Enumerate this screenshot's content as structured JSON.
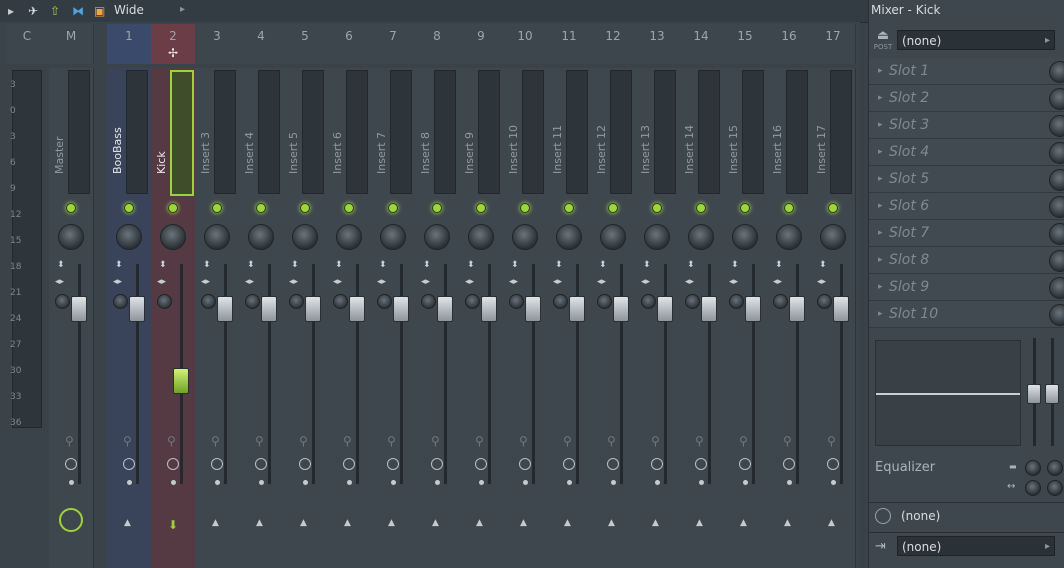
{
  "toolbar": {
    "mode_label": "Wide"
  },
  "mixer": {
    "headers": [
      "C",
      "M",
      "1",
      "2",
      "3",
      "4",
      "5",
      "6",
      "7",
      "8",
      "9",
      "10",
      "11",
      "12",
      "13",
      "14",
      "15",
      "16",
      "17"
    ],
    "selected_track": "2",
    "meter_scale": [
      "3",
      "0",
      "3",
      "6",
      "9",
      "12",
      "15",
      "18",
      "21",
      "24",
      "27",
      "30",
      "33",
      "36"
    ],
    "tracks": [
      {
        "id": "M",
        "name": "Master"
      },
      {
        "id": "1",
        "name": "BooBass"
      },
      {
        "id": "2",
        "name": "Kick"
      },
      {
        "id": "3",
        "name": "Insert 3"
      },
      {
        "id": "4",
        "name": "Insert 4"
      },
      {
        "id": "5",
        "name": "Insert 5"
      },
      {
        "id": "6",
        "name": "Insert 6"
      },
      {
        "id": "7",
        "name": "Insert 7"
      },
      {
        "id": "8",
        "name": "Insert 8"
      },
      {
        "id": "9",
        "name": "Insert 9"
      },
      {
        "id": "10",
        "name": "Insert 10"
      },
      {
        "id": "11",
        "name": "Insert 11"
      },
      {
        "id": "12",
        "name": "Insert 12"
      },
      {
        "id": "13",
        "name": "Insert 13"
      },
      {
        "id": "14",
        "name": "Insert 14"
      },
      {
        "id": "15",
        "name": "Insert 15"
      },
      {
        "id": "16",
        "name": "Insert 16"
      },
      {
        "id": "17",
        "name": "Insert 17"
      }
    ]
  },
  "panel": {
    "title": "Mixer - Kick",
    "post_label": "POST",
    "input_value": "(none)",
    "slots": [
      "Slot 1",
      "Slot 2",
      "Slot 3",
      "Slot 4",
      "Slot 5",
      "Slot 6",
      "Slot 7",
      "Slot 8",
      "Slot 9",
      "Slot 10"
    ],
    "equalizer_label": "Equalizer",
    "latency_value": "(none)",
    "output_value": "(none)"
  },
  "colors": {
    "accent_green": "#9ed23b",
    "selected_blue": "#3a4a6a",
    "selected_red": "#6a3d47"
  }
}
